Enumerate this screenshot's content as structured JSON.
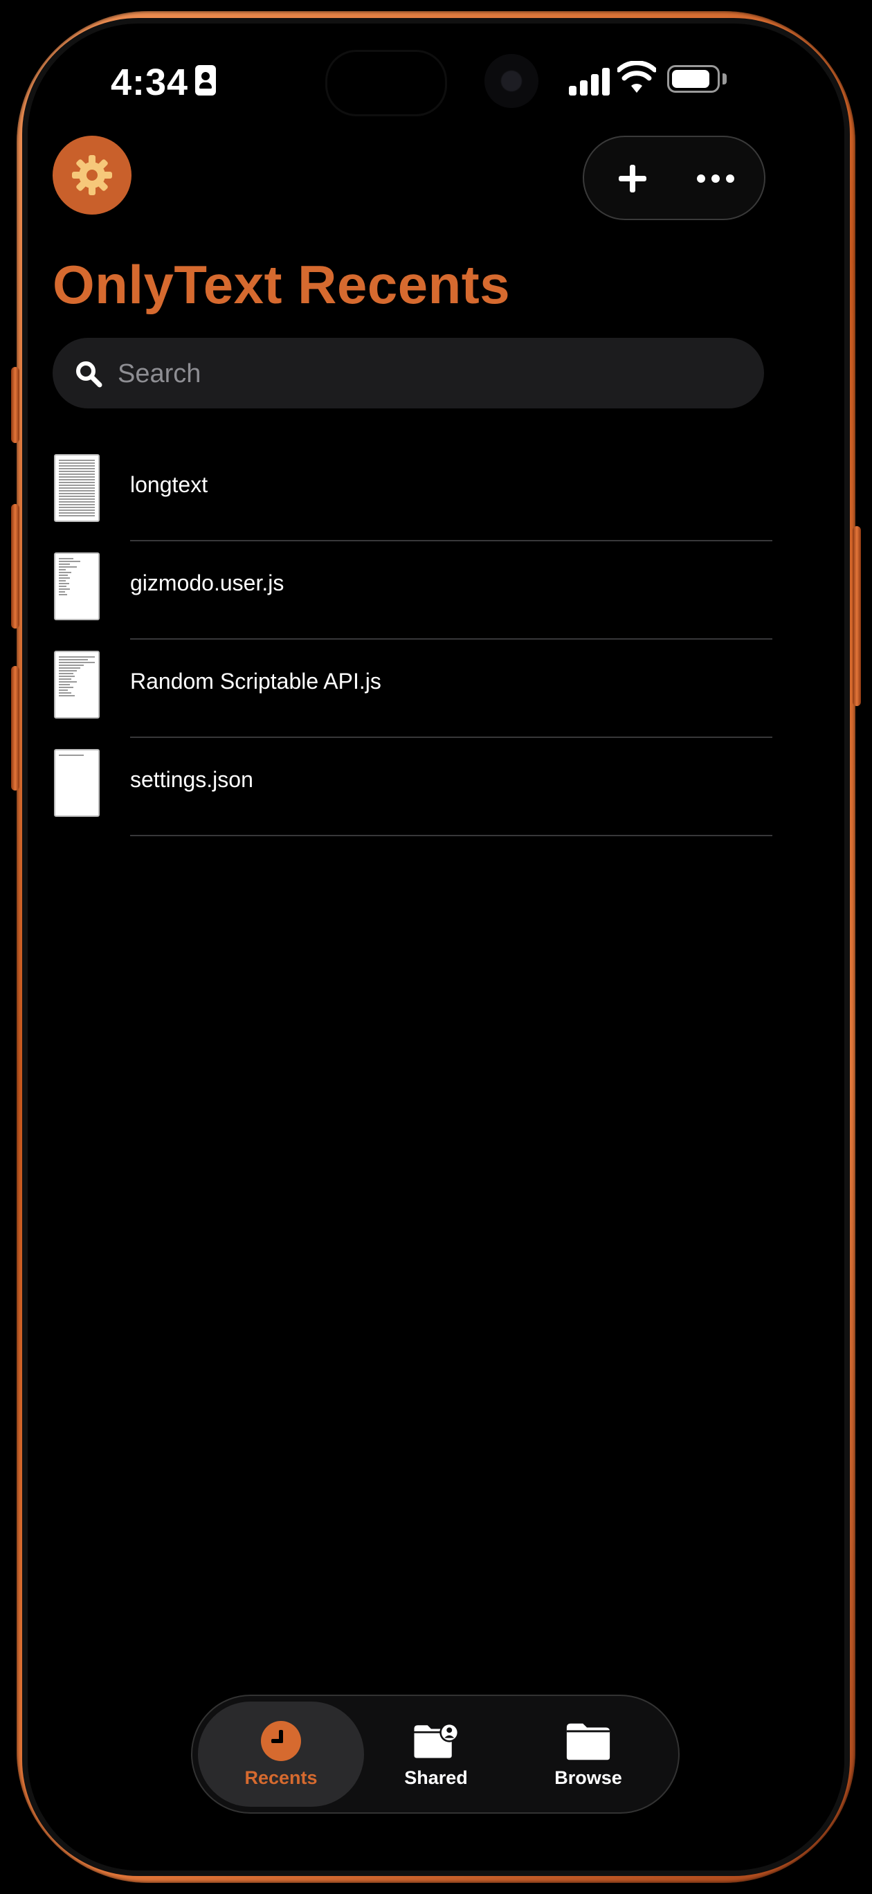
{
  "status_bar": {
    "time": "4:34",
    "icons": [
      "id-card-icon",
      "cellular-signal-icon",
      "wifi-icon",
      "battery-icon"
    ]
  },
  "toolbar": {
    "settings_icon": "gear-icon",
    "add_icon": "plus-icon",
    "more_icon": "ellipsis-icon"
  },
  "header": {
    "title": "OnlyText Recents"
  },
  "search": {
    "placeholder": "Search",
    "value": ""
  },
  "files": [
    {
      "name": "longtext"
    },
    {
      "name": "gizmodo.user.js"
    },
    {
      "name": "Random Scriptable API.js"
    },
    {
      "name": "settings.json"
    }
  ],
  "tabbar": {
    "tabs": [
      {
        "label": "Recents",
        "icon": "clock-icon",
        "active": true
      },
      {
        "label": "Shared",
        "icon": "shared-folder-icon",
        "active": false
      },
      {
        "label": "Browse",
        "icon": "folder-icon",
        "active": false
      }
    ]
  },
  "colors": {
    "accent": "#d66a2f",
    "frame": "#c9591e",
    "background": "#000000"
  }
}
